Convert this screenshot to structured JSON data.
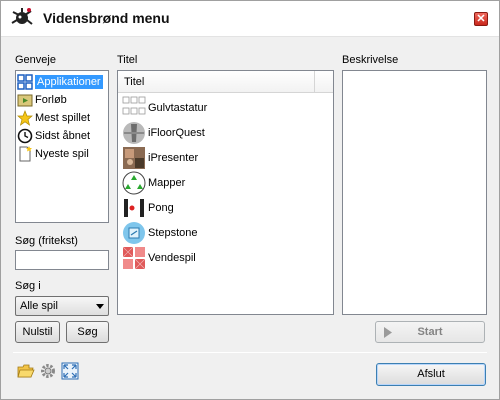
{
  "window": {
    "title": "Vidensbrønd menu",
    "close_glyph": "✕"
  },
  "categories": {
    "label": "Genveje",
    "items": [
      {
        "label": "Applikationer",
        "icon": "applications-icon",
        "selected": true
      },
      {
        "label": "Forløb",
        "icon": "film-icon",
        "selected": false
      },
      {
        "label": "Mest spillet",
        "icon": "star-icon",
        "selected": false
      },
      {
        "label": "Sidst åbnet",
        "icon": "clock-icon",
        "selected": false
      },
      {
        "label": "Nyeste spil",
        "icon": "new-document-icon",
        "selected": false
      }
    ]
  },
  "titles": {
    "label": "Titel",
    "column_header": "Titel",
    "items": [
      {
        "label": "Gulvtastatur",
        "icon": "keypad-icon"
      },
      {
        "label": "iFloorQuest",
        "icon": "floorquest-icon"
      },
      {
        "label": "iPresenter",
        "icon": "presenter-icon"
      },
      {
        "label": "Mapper",
        "icon": "mapper-icon"
      },
      {
        "label": "Pong",
        "icon": "pong-icon"
      },
      {
        "label": "Stepstone",
        "icon": "stepstone-icon"
      },
      {
        "label": "Vendespil",
        "icon": "memory-cards-icon"
      }
    ]
  },
  "description": {
    "label": "Beskrivelse"
  },
  "search": {
    "label": "Søg (fritekst)",
    "value": "",
    "scope_label": "Søg i",
    "scope_value": "Alle spil",
    "reset_label": "Nulstil",
    "search_label": "Søg"
  },
  "buttons": {
    "start": "Start",
    "exit": "Afslut"
  },
  "toolbar": {
    "icons": [
      "open-folder-icon",
      "settings-gear-icon",
      "fullscreen-icon"
    ]
  },
  "colors": {
    "selection": "#3399ff",
    "close_red": "#d0352b",
    "panel_border": "#828790"
  }
}
